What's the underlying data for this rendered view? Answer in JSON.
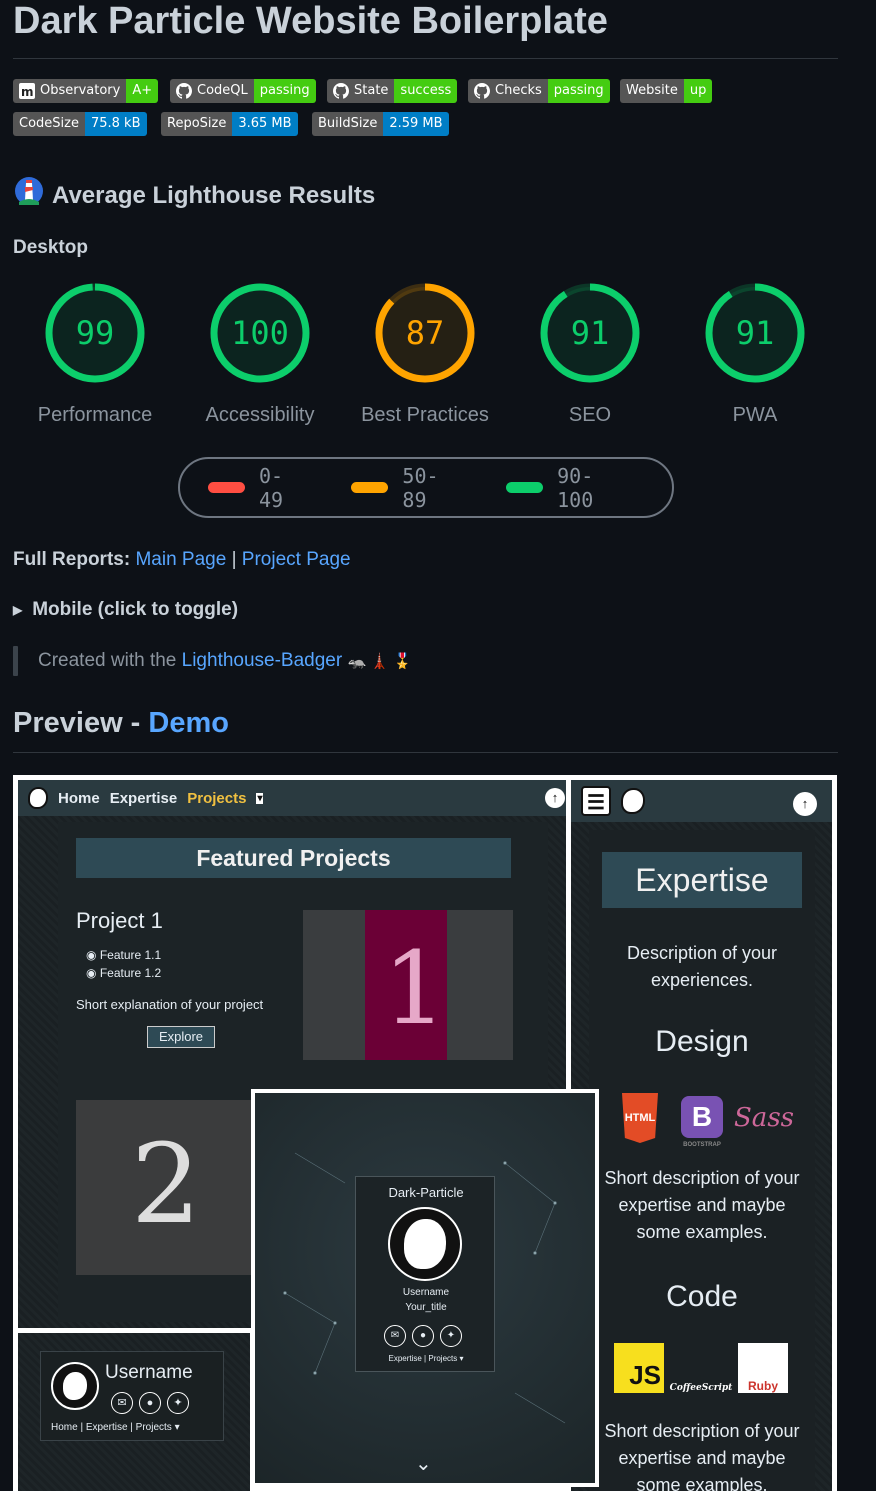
{
  "title": "Dark Particle Website Boilerplate",
  "badges_row1": [
    {
      "label": "Observatory",
      "value": "A+",
      "color": "#4c1",
      "icon": "mozilla-icon"
    },
    {
      "label": "CodeQL",
      "value": "passing",
      "color": "#4c1",
      "icon": "github-icon"
    },
    {
      "label": "State",
      "value": "success",
      "color": "#4c1",
      "icon": "github-icon"
    },
    {
      "label": "Checks",
      "value": "passing",
      "color": "#4c1",
      "icon": "github-icon"
    },
    {
      "label": "Website",
      "value": "up",
      "color": "#4c1",
      "icon": ""
    }
  ],
  "badges_row2": [
    {
      "label": "CodeSize",
      "value": "75.8 kB",
      "color": "#007ec6"
    },
    {
      "label": "RepoSize",
      "value": "3.65 MB",
      "color": "#007ec6"
    },
    {
      "label": "BuildSize",
      "value": "2.59 MB",
      "color": "#007ec6"
    }
  ],
  "lighthouse": {
    "title": "Average Lighthouse Results",
    "subtitle": "Desktop",
    "scores": [
      {
        "value": "99",
        "label": "Performance",
        "color": "#0cce6b",
        "fraction": 0.99
      },
      {
        "value": "100",
        "label": "Accessibility",
        "color": "#0cce6b",
        "fraction": 1.0
      },
      {
        "value": "87",
        "label": "Best Practices",
        "color": "#ffa400",
        "fraction": 0.87
      },
      {
        "value": "91",
        "label": "SEO",
        "color": "#0cce6b",
        "fraction": 0.91
      },
      {
        "value": "91",
        "label": "PWA",
        "color": "#0cce6b",
        "fraction": 0.91
      }
    ],
    "legend": [
      {
        "range": "0-49",
        "color": "#ff4e42"
      },
      {
        "range": "50-89",
        "color": "#ffa400"
      },
      {
        "range": "90-100",
        "color": "#0cce6b"
      }
    ]
  },
  "reports": {
    "label": "Full Reports:",
    "main_link": "Main Page",
    "separator": "|",
    "project_link": "Project Page"
  },
  "mobile_toggle": "Mobile (click to toggle)",
  "credit": {
    "prefix": "Created with the",
    "link": "Lighthouse-Badger",
    "emoji": "🦡 🗼 🎖️"
  },
  "preview": {
    "heading": "Preview -",
    "demo_link": "Demo",
    "left_panel": {
      "nav": [
        "Home",
        "Expertise",
        "Projects"
      ],
      "nav_active": "Projects",
      "dropdown_glyph": "▾",
      "up_glyph": "↑",
      "featured": "Featured Projects",
      "project_title": "Project 1",
      "features": [
        "Feature 1.1",
        "Feature 1.2"
      ],
      "explanation": "Short explanation of your project",
      "explore": "Explore",
      "image1_digit": "1",
      "image2_digit": "2"
    },
    "right_panel": {
      "menu_glyph": "☰",
      "title": "Expertise",
      "description": "Description of your experiences.",
      "design": "Design",
      "design_icons": [
        "HTML",
        "B",
        "Sass"
      ],
      "bootstrap_caption": "BOOTSTRAP",
      "short1": "Short description of your expertise and maybe some examples.",
      "code": "Code",
      "code_icons": [
        "JS",
        "CoffeeScript",
        "Ruby"
      ],
      "short2": "Short description of your expertise and maybe some examples."
    },
    "center_card": {
      "name": "Dark-Particle",
      "username": "Username",
      "user_title": "Your_title",
      "footer": "Expertise | Projects ▾",
      "scroll_glyph": "⌄"
    },
    "bottom_left": {
      "username": "Username",
      "nav": "Home | Expertise | Projects ▾"
    }
  }
}
